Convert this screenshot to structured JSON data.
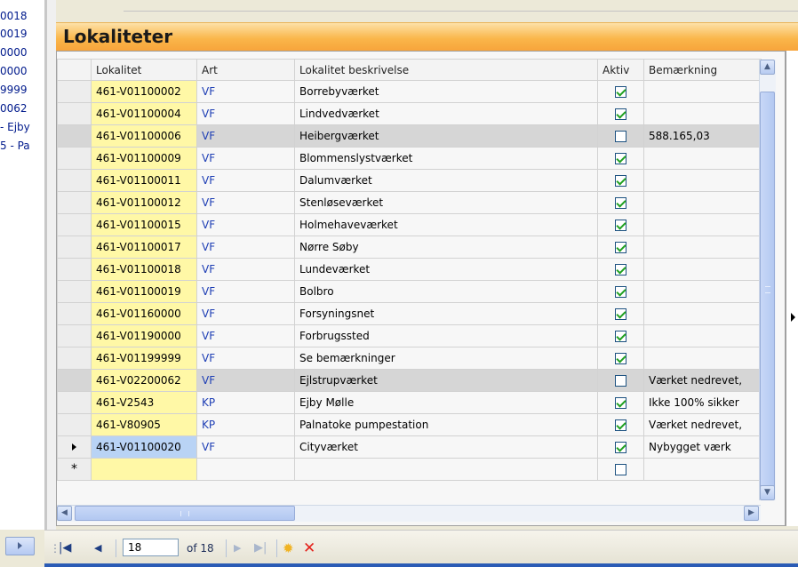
{
  "left_list": [
    "0018",
    "0019",
    "0000",
    "0000",
    "9999",
    "0062",
    "- Ejby",
    "5 - Pa"
  ],
  "title": "Lokaliteter",
  "columns": [
    "Lokalitet",
    "Art",
    "Lokalitet beskrivelse",
    "Aktiv",
    "Bemærkning"
  ],
  "rows": [
    {
      "lokalitet": "461-V01100002",
      "art": "VF",
      "beskrivelse": "Borrebyværket",
      "aktiv": true,
      "bemaerkning": ""
    },
    {
      "lokalitet": "461-V01100004",
      "art": "VF",
      "beskrivelse": "Lindvedværket",
      "aktiv": true,
      "bemaerkning": ""
    },
    {
      "lokalitet": "461-V01100006",
      "art": "VF",
      "beskrivelse": "Heibergværket",
      "aktiv": false,
      "bemaerkning": "588.165,03"
    },
    {
      "lokalitet": "461-V01100009",
      "art": "VF",
      "beskrivelse": "Blommenslystværket",
      "aktiv": true,
      "bemaerkning": ""
    },
    {
      "lokalitet": "461-V01100011",
      "art": "VF",
      "beskrivelse": "Dalumværket",
      "aktiv": true,
      "bemaerkning": ""
    },
    {
      "lokalitet": "461-V01100012",
      "art": "VF",
      "beskrivelse": "Stenløseværket",
      "aktiv": true,
      "bemaerkning": ""
    },
    {
      "lokalitet": "461-V01100015",
      "art": "VF",
      "beskrivelse": "Holmehaveværket",
      "aktiv": true,
      "bemaerkning": ""
    },
    {
      "lokalitet": "461-V01100017",
      "art": "VF",
      "beskrivelse": "Nørre Søby",
      "aktiv": true,
      "bemaerkning": ""
    },
    {
      "lokalitet": "461-V01100018",
      "art": "VF",
      "beskrivelse": "Lundeværket",
      "aktiv": true,
      "bemaerkning": ""
    },
    {
      "lokalitet": "461-V01100019",
      "art": "VF",
      "beskrivelse": "Bolbro",
      "aktiv": true,
      "bemaerkning": ""
    },
    {
      "lokalitet": "461-V01160000",
      "art": "VF",
      "beskrivelse": "Forsyningsnet",
      "aktiv": true,
      "bemaerkning": ""
    },
    {
      "lokalitet": "461-V01190000",
      "art": "VF",
      "beskrivelse": "Forbrugssted",
      "aktiv": true,
      "bemaerkning": ""
    },
    {
      "lokalitet": "461-V01199999",
      "art": "VF",
      "beskrivelse": "Se bemærkninger",
      "aktiv": true,
      "bemaerkning": ""
    },
    {
      "lokalitet": "461-V02200062",
      "art": "VF",
      "beskrivelse": "Ejlstrupværket",
      "aktiv": false,
      "bemaerkning": "Værket nedrevet,"
    },
    {
      "lokalitet": "461-V2543",
      "art": "KP",
      "beskrivelse": "Ejby Mølle",
      "aktiv": true,
      "bemaerkning": "Ikke 100% sikker"
    },
    {
      "lokalitet": "461-V80905",
      "art": "KP",
      "beskrivelse": "Palnatoke pumpestation",
      "aktiv": true,
      "bemaerkning": "Værket nedrevet,"
    },
    {
      "lokalitet": "461-V01100020",
      "art": "VF",
      "beskrivelse": "Cityværket",
      "aktiv": true,
      "bemaerkning": "Nybygget værk"
    }
  ],
  "new_row_marker": "*",
  "navigator": {
    "current": "18",
    "of_text": "of 18"
  }
}
